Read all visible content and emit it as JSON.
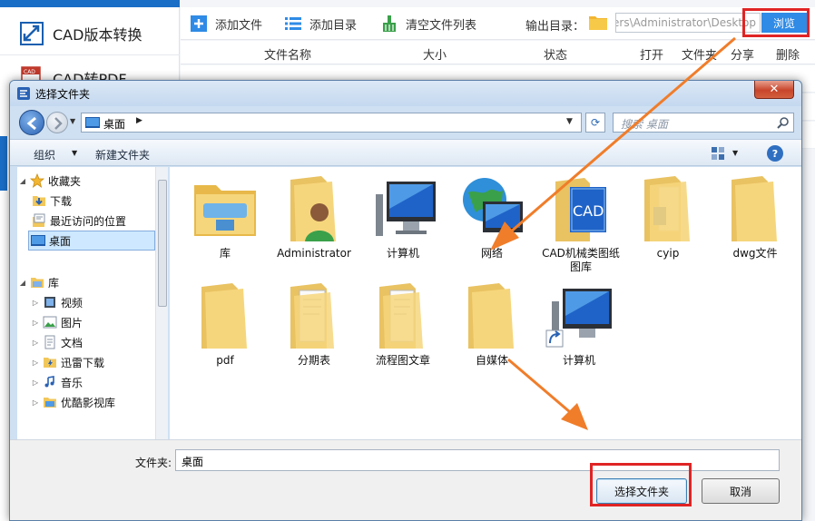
{
  "app": {
    "nav": [
      {
        "label": "CAD版本转换"
      },
      {
        "label": "CAD转PDF"
      }
    ],
    "toolbar": {
      "add_file": "添加文件",
      "add_dir": "添加目录",
      "clear_list": "清空文件列表",
      "output_label": "输出目录：",
      "output_path": "ers\\Administrator\\Desktop",
      "browse": "浏览"
    },
    "table_headers": {
      "name": "文件名称",
      "size": "大小",
      "status": "状态",
      "open": "打开",
      "folder": "文件夹",
      "share": "分享",
      "delete": "删除"
    }
  },
  "dialog": {
    "title": "选择文件夹",
    "address": "桌面",
    "search_placeholder": "搜索 桌面",
    "commands": {
      "organize": "组织",
      "new_folder": "新建文件夹"
    },
    "tree": [
      {
        "label": "收藏夹",
        "icon": "star-icon",
        "level": 0
      },
      {
        "label": "下载",
        "icon": "download-folder-icon",
        "level": 1
      },
      {
        "label": "最近访问的位置",
        "icon": "recent-places-icon",
        "level": 1
      },
      {
        "label": "桌面",
        "icon": "desktop-icon",
        "level": 1,
        "selected": true
      },
      {
        "label": "库",
        "icon": "library-icon",
        "level": 0
      },
      {
        "label": "视频",
        "icon": "video-library-icon",
        "level": 1
      },
      {
        "label": "图片",
        "icon": "pictures-library-icon",
        "level": 1
      },
      {
        "label": "文档",
        "icon": "documents-library-icon",
        "level": 1
      },
      {
        "label": "迅雷下载",
        "icon": "thunder-download-icon",
        "level": 1
      },
      {
        "label": "音乐",
        "icon": "music-library-icon",
        "level": 1
      },
      {
        "label": "优酷影视库",
        "icon": "youku-library-icon",
        "level": 1
      }
    ],
    "files": [
      {
        "label": "库",
        "icon": "library-folder-icon"
      },
      {
        "label": "Administrator",
        "icon": "user-folder-icon"
      },
      {
        "label": "计算机",
        "icon": "computer-icon"
      },
      {
        "label": "网络",
        "icon": "network-icon"
      },
      {
        "label": "CAD机械类图纸图库",
        "icon": "cad-folder-icon"
      },
      {
        "label": "cyip",
        "icon": "folder-icon"
      },
      {
        "label": "dwg文件",
        "icon": "folder-icon"
      },
      {
        "label": "pdf",
        "icon": "folder-icon"
      },
      {
        "label": "分期表",
        "icon": "document-folder-icon"
      },
      {
        "label": "流程图文章",
        "icon": "document-folder-icon"
      },
      {
        "label": "自媒体",
        "icon": "folder-icon"
      },
      {
        "label": "计算机",
        "icon": "computer-shortcut-icon"
      }
    ],
    "folder_label": "文件夹:",
    "folder_value": "桌面",
    "select_button": "选择文件夹",
    "cancel_button": "取消"
  },
  "colors": {
    "accent": "#2f8be6",
    "highlight": "#e02424",
    "arrow": "#f07d2a"
  }
}
